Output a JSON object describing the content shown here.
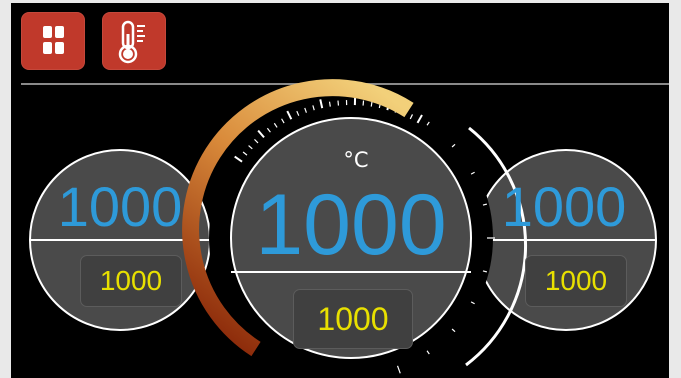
{
  "toolbar": {
    "buttons": [
      {
        "icon": "grid-icon"
      },
      {
        "icon": "thermometer-icon"
      }
    ]
  },
  "colors": {
    "button_bg": "#c0392b",
    "main_value": "#2e9ad9",
    "setpoint_value": "#e8e000",
    "dial_face": "#4a4a4a",
    "arc_start": "#f2d07a",
    "arc_end": "#8c2a0a"
  },
  "dials": {
    "left": {
      "value": "1000",
      "setpoint": "1000"
    },
    "center": {
      "unit": "°C",
      "value": "1000",
      "setpoint": "1000"
    },
    "right": {
      "value": "1000",
      "setpoint": "1000"
    }
  }
}
